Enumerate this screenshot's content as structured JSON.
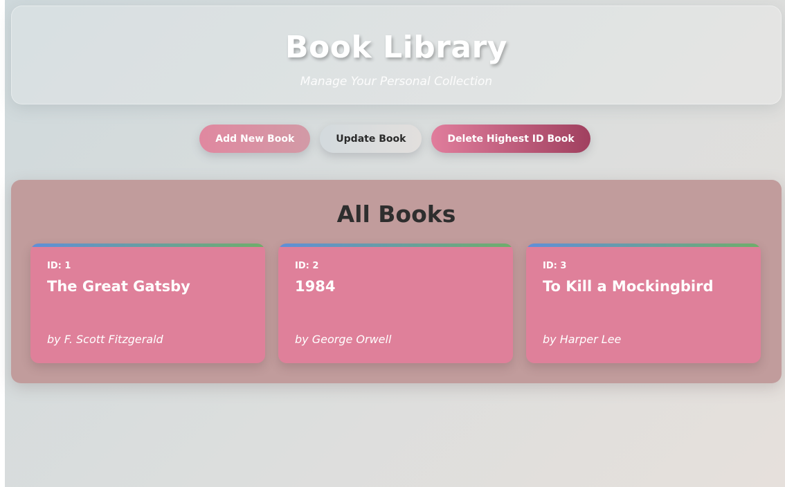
{
  "header": {
    "title": "Book Library",
    "subtitle": "Manage Your Personal Collection"
  },
  "actions": {
    "add_label": "Add New Book",
    "update_label": "Update Book",
    "delete_label": "Delete Highest ID Book"
  },
  "books_panel": {
    "title": "All Books",
    "books": [
      {
        "id_label": "ID: 1",
        "title": "The Great Gatsby",
        "author": "by F. Scott Fitzgerald"
      },
      {
        "id_label": "ID: 2",
        "title": "1984",
        "author": "by George Orwell"
      },
      {
        "id_label": "ID: 3",
        "title": "To Kill a Mockingbird",
        "author": "by Harper Lee"
      }
    ]
  },
  "colors": {
    "card": "#df809a",
    "panel": "#c19c9c",
    "accent_start": "#5f8fd8",
    "accent_end": "#6fae6a",
    "delete_dark": "#a0405f"
  }
}
